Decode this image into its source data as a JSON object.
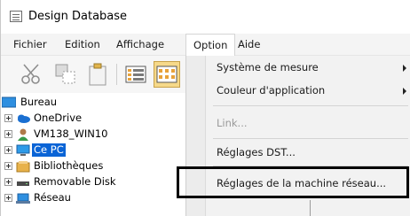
{
  "window": {
    "title": "Design Database"
  },
  "menubar": {
    "items": [
      "Fichier",
      "Edition",
      "Affichage",
      "Option",
      "Aide"
    ],
    "active": "Option"
  },
  "toolbar": {
    "buttons": [
      "scissors-icon",
      "copy-icon",
      "paste-icon",
      "list-view-icon",
      "grid-view-icon"
    ]
  },
  "tree": {
    "items": [
      {
        "label": "Bureau",
        "icon": "desktop-icon",
        "selected": false
      },
      {
        "label": "OneDrive",
        "icon": "cloud-icon",
        "selected": false
      },
      {
        "label": "VM138_WIN10",
        "icon": "user-icon",
        "selected": false
      },
      {
        "label": "Ce PC",
        "icon": "computer-icon",
        "selected": true
      },
      {
        "label": "Bibliothèques",
        "icon": "library-icon",
        "selected": false
      },
      {
        "label": "Removable Disk",
        "icon": "drive-icon",
        "selected": false
      },
      {
        "label": "Réseau",
        "icon": "network-icon",
        "selected": false
      }
    ]
  },
  "dropdown": {
    "items": [
      {
        "label": "Système de mesure",
        "enabled": true,
        "submenu": true
      },
      {
        "label": "Couleur d'application",
        "enabled": true,
        "submenu": true
      },
      {
        "label": "Link...",
        "enabled": false,
        "submenu": false
      },
      {
        "label": "Réglages DST...",
        "enabled": true,
        "submenu": false
      },
      {
        "label": "Réglages de la machine réseau...",
        "enabled": true,
        "submenu": false,
        "highlighted": true
      }
    ]
  },
  "colors": {
    "selection": "#0a64d6",
    "menu_background": "#f2f2f2",
    "disabled_text": "#9a9a9a",
    "highlight_border": "#000000"
  }
}
